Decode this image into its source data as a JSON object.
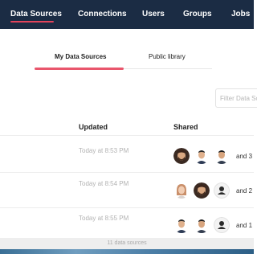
{
  "nav": {
    "items": [
      {
        "label": "Data Sources",
        "active": true
      },
      {
        "label": "Connections"
      },
      {
        "label": "Users"
      },
      {
        "label": "Groups"
      },
      {
        "label": "Jobs"
      }
    ],
    "active_color": "#e2435b",
    "background": "#1b2c44"
  },
  "tabs": {
    "items": [
      {
        "label": "My Data Sources",
        "active": true
      },
      {
        "label": "Public library"
      }
    ]
  },
  "filter": {
    "placeholder": "Filter Data Sources"
  },
  "table": {
    "headers": {
      "updated": "Updated",
      "shared": "Shared"
    },
    "rows": [
      {
        "updated": "Today at 8:53 PM",
        "avatars": [
          "man-beard-avatar",
          "man-avatar",
          "man-avatar"
        ],
        "more": "and 3"
      },
      {
        "updated": "Today at 8:54 PM",
        "avatars": [
          "woman-avatar",
          "man-beard-avatar",
          "default-user-avatar"
        ],
        "more": "and 2"
      },
      {
        "updated": "Today at 8:55 PM",
        "avatars": [
          "man-avatar",
          "man-avatar",
          "default-user-avatar"
        ],
        "more": "and 1"
      }
    ]
  },
  "footer": {
    "count_text": "11 data sources"
  }
}
